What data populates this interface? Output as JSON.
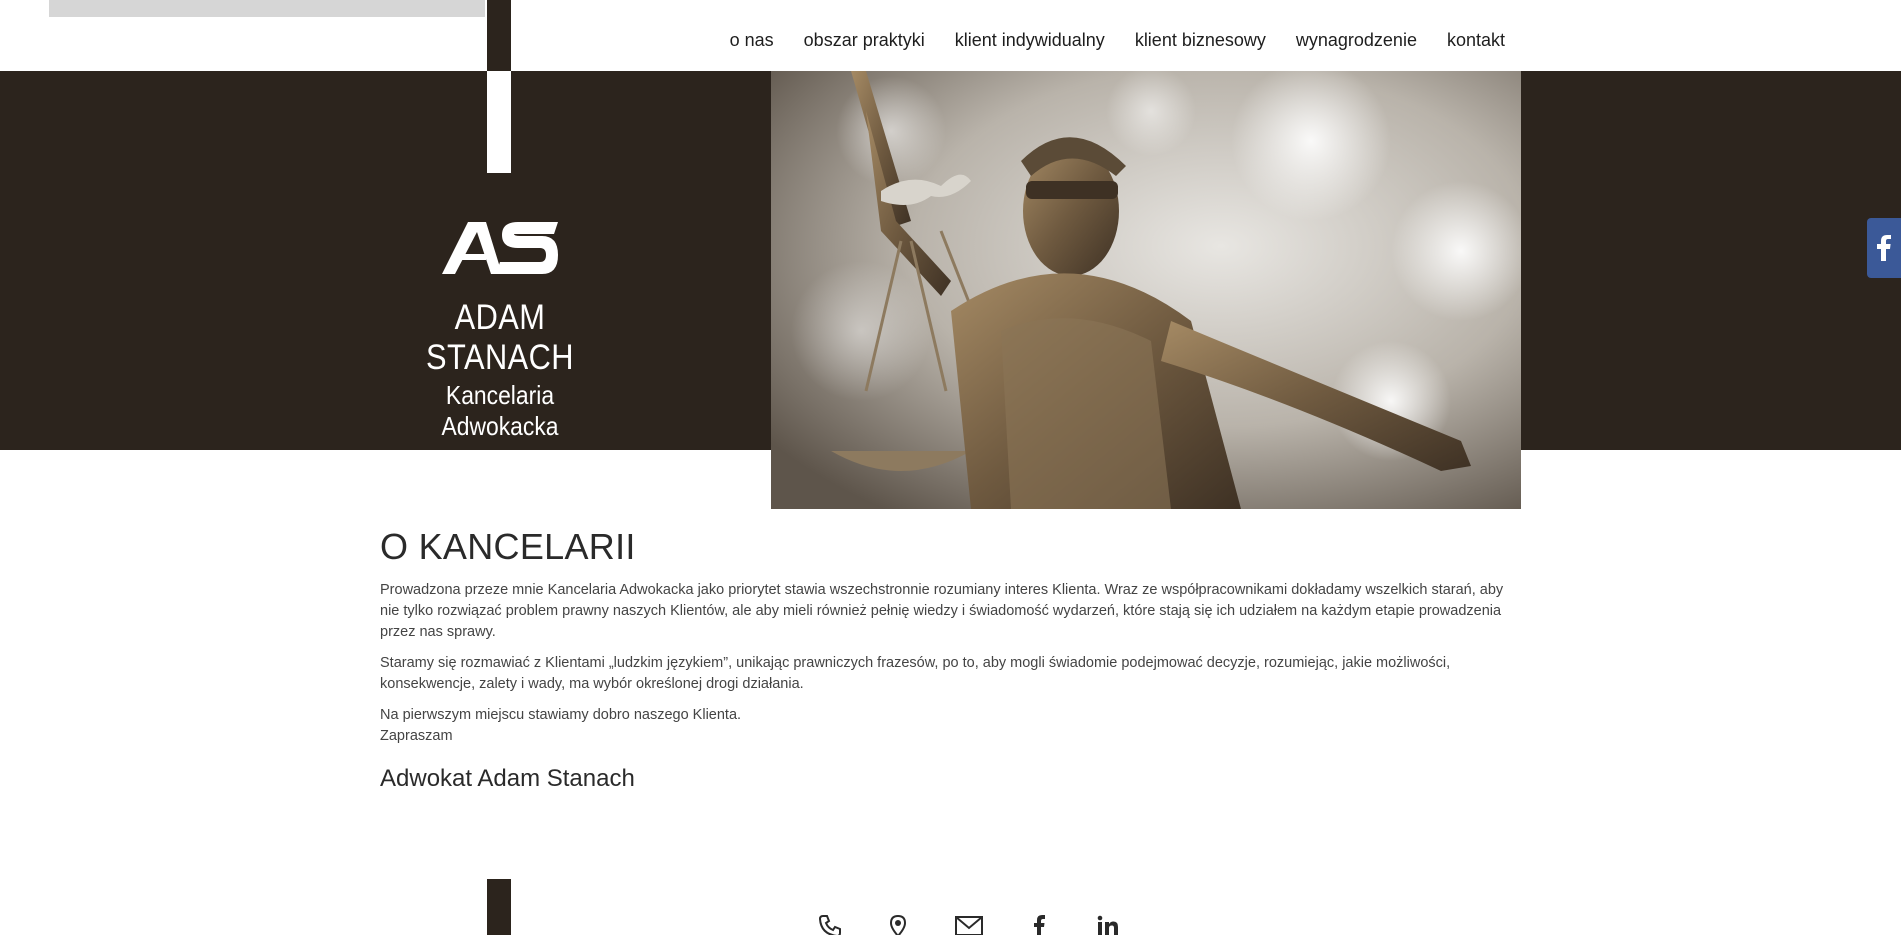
{
  "nav": {
    "items": [
      "o nas",
      "obszar praktyki",
      "klient indywidualny",
      "klient biznesowy",
      "wynagrodzenie",
      "kontakt"
    ]
  },
  "logo": {
    "mark": "AS",
    "name": "ADAM STANACH",
    "subtitle": "Kancelaria Adwokacka"
  },
  "content": {
    "title": "O KANCELARII",
    "paragraphs": [
      "Prowadzona przeze mnie Kancelaria Adwokacka jako priorytet stawia wszechstronnie rozumiany interes Klienta. Wraz ze współpracownikami dokładamy wszelkich starań, aby nie tylko rozwiązać problem prawny naszych Klientów, ale aby mieli również pełnię wiedzy i świadomość wydarzeń, które stają się ich udziałem na każdym etapie prowadzenia przez nas sprawy.",
      "Staramy się rozmawiać z Klientami „ludzkim językiem”, unikając prawniczych frazesów, po to, aby mogli świadomie podejmować decyzje, rozumiejąc, jakie możliwości, konsekwencje, zalety i wady, ma wybór określonej drogi działania.",
      "Na pierwszym miejscu stawiamy dobro naszego Klienta.",
      "Zapraszam"
    ],
    "signature": "Adwokat Adam Stanach"
  },
  "footer": {
    "icons": [
      "phone-icon",
      "location-pin-icon",
      "envelope-icon",
      "facebook-icon",
      "linkedin-icon"
    ]
  },
  "colors": {
    "brand_dark": "#2c241d",
    "facebook": "#3b5998"
  }
}
